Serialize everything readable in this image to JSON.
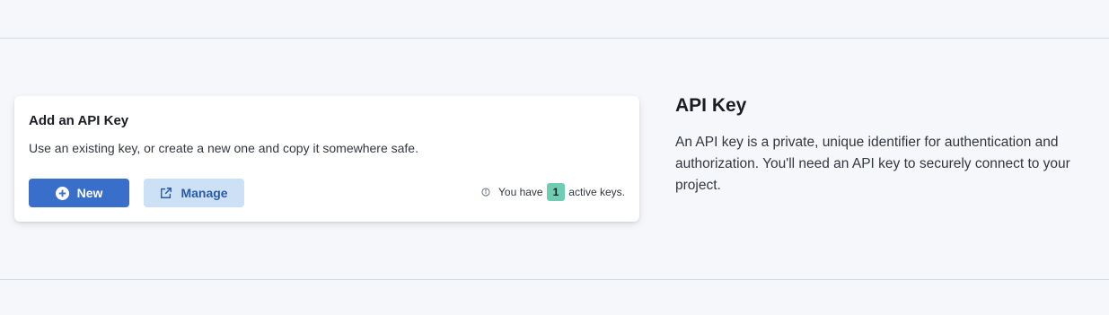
{
  "card": {
    "title": "Add an API Key",
    "description": "Use an existing key, or create a new one and copy it somewhere safe.",
    "new_button": {
      "label": "New",
      "icon": "plus-circle-icon"
    },
    "manage_button": {
      "label": "Manage",
      "icon": "external-link-icon"
    },
    "active_keys": {
      "prefix": "You have",
      "count": "1",
      "suffix": "active keys.",
      "icon": "info-icon"
    }
  },
  "side": {
    "title": "API Key",
    "description": "An API key is a private, unique identifier for authentication and authorization. You'll need an API key to securely connect to your project."
  },
  "colors": {
    "background": "#f6f7fa",
    "primary": "#3a6ecb",
    "secondary_bg": "#cce1f5",
    "badge": "#6dccb1"
  }
}
